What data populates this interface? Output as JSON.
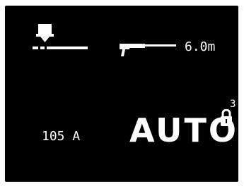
{
  "display": {
    "background": "#000000",
    "foreground": "#ffffff"
  },
  "icons": {
    "tool": "wire-feeder-icon",
    "torch": "torch-hose-icon",
    "lock": "padlock-icon"
  },
  "readouts": {
    "length": "6.0m",
    "current": "105 A",
    "mode": "AUTO",
    "lock_level": "3"
  }
}
